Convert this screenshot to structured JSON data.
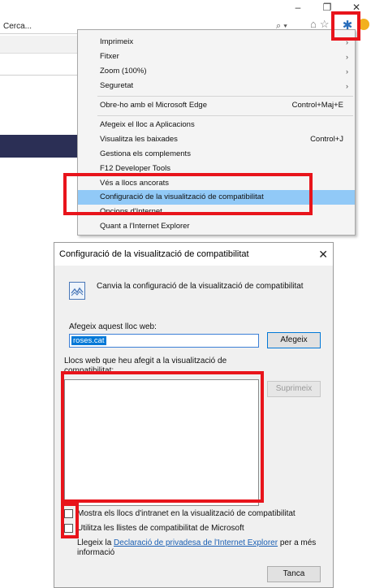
{
  "browser": {
    "window_controls": [
      "–",
      "❐",
      "✕"
    ],
    "address_text": "Cerca...",
    "search_glyph": "⌕ ▾",
    "nav_icons": [
      "home-icon",
      "star-icon"
    ],
    "tools_icon": "gear-icon",
    "accent": "#2a6ebb"
  },
  "menu": {
    "items": [
      {
        "label": "Imprimeix",
        "submenu": true,
        "shortcut": ""
      },
      {
        "label": "Fitxer",
        "submenu": true,
        "shortcut": ""
      },
      {
        "label": "Zoom (100%)",
        "submenu": true,
        "shortcut": ""
      },
      {
        "label": "Seguretat",
        "submenu": true,
        "shortcut": ""
      },
      {
        "label": "Obre-ho amb el Microsoft Edge",
        "submenu": false,
        "shortcut": "Control+Maj+E"
      },
      {
        "label": "Afegeix el lloc a Aplicacions",
        "submenu": false,
        "shortcut": ""
      },
      {
        "label": "Visualitza les baixades",
        "submenu": false,
        "shortcut": "Control+J"
      },
      {
        "label": "Gestiona els complements",
        "submenu": false,
        "shortcut": ""
      },
      {
        "label": "F12 Developer Tools",
        "submenu": false,
        "shortcut": ""
      },
      {
        "label": "Vés a llocs ancorats",
        "submenu": false,
        "shortcut": ""
      },
      {
        "label": "Configuració de la visualització de compatibilitat",
        "submenu": false,
        "shortcut": "",
        "highlighted": true
      },
      {
        "label": "Opcions d'Internet",
        "submenu": false,
        "shortcut": ""
      },
      {
        "label": "Quant a l'Internet Explorer",
        "submenu": false,
        "shortcut": ""
      }
    ],
    "highlight_color": "#91c9f7"
  },
  "dialog": {
    "title": "Configuració de la visualització de compatibilitat",
    "close_glyph": "✕",
    "heading": "Canvia la configuració de la visualització de compatibilitat",
    "add_label": "Afegeix aquest lloc web:",
    "add_value": "roses.cat",
    "add_button": "Afegeix",
    "list_label_line1": "Llocs web que heu afegit a la visualització de",
    "list_label_line2": "compatibilitat:",
    "remove_button": "Suprimeix",
    "checkbox_intranet": "Mostra els llocs d'intranet en la visualització de compatibilitat",
    "checkbox_microsoft": "Utilitza les llistes de compatibilitat de Microsoft",
    "privacy_prefix": "Llegeix la ",
    "privacy_link": "Declaració de privadesa de l'Internet Explorer",
    "privacy_suffix": " per a més",
    "privacy_line2": "informació",
    "close_button": "Tanca"
  },
  "annotation_color": "#e8141b"
}
